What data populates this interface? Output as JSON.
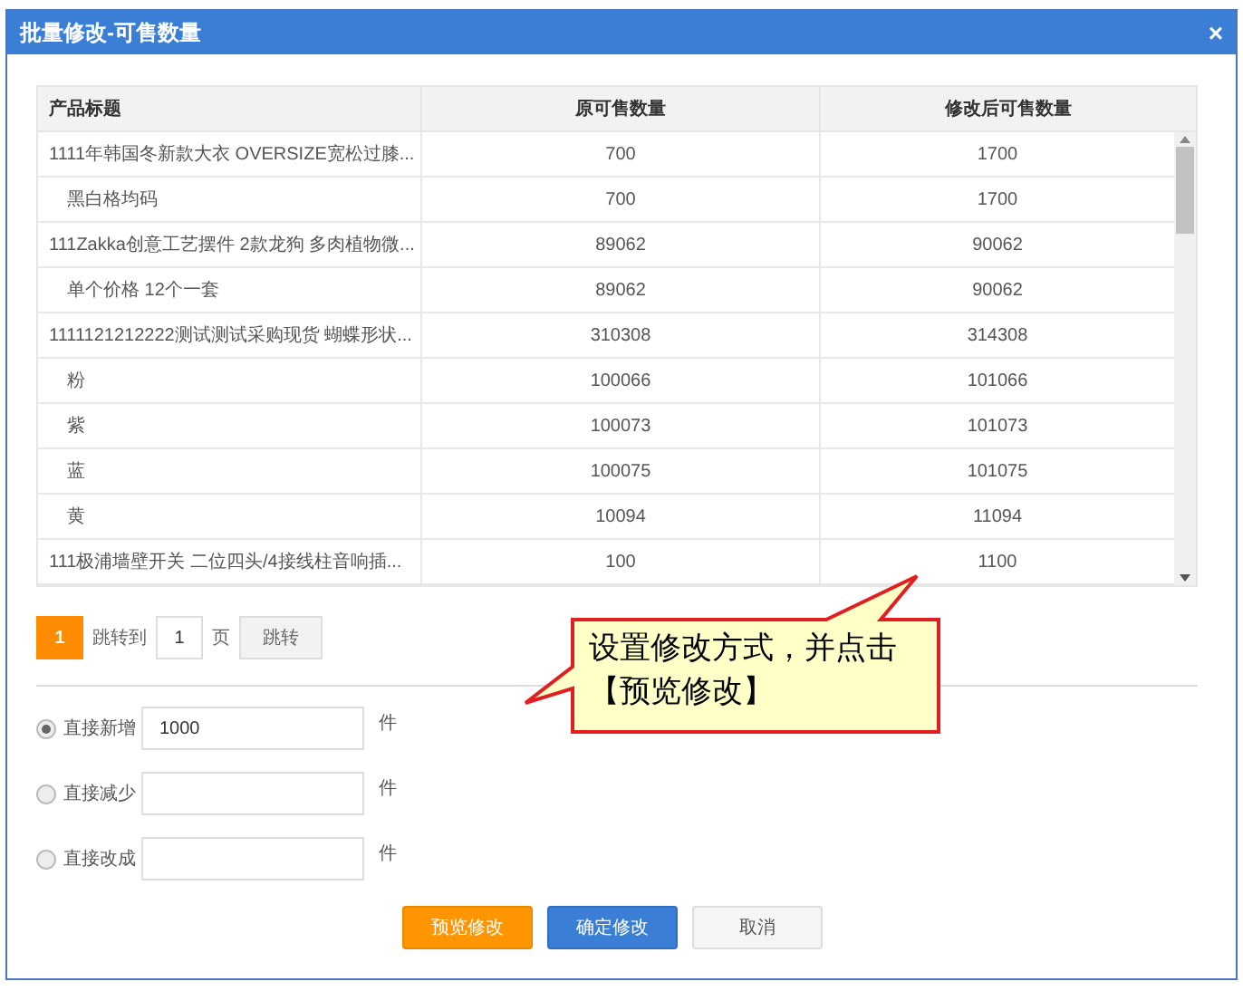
{
  "dialog": {
    "title": "批量修改-可售数量",
    "close": "×"
  },
  "table": {
    "columns": [
      "产品标题",
      "原可售数量",
      "修改后可售数量"
    ],
    "rows": [
      {
        "kind": "product",
        "title": "1111年韩国冬新款大衣 OVERSIZE宽松过膝...",
        "original": "700",
        "modified": "1700"
      },
      {
        "kind": "variant",
        "title": "黑白格均码",
        "original": "700",
        "modified": "1700"
      },
      {
        "kind": "product",
        "title": "111Zakka创意工艺摆件 2款龙狗 多肉植物微...",
        "original": "89062",
        "modified": "90062"
      },
      {
        "kind": "variant",
        "title": "单个价格 12个一套",
        "original": "89062",
        "modified": "90062"
      },
      {
        "kind": "product",
        "title": "1111121212222测试测试采购现货 蝴蝶形状...",
        "original": "310308",
        "modified": "314308"
      },
      {
        "kind": "variant",
        "title": "粉",
        "original": "100066",
        "modified": "101066"
      },
      {
        "kind": "variant",
        "title": "紫",
        "original": "100073",
        "modified": "101073"
      },
      {
        "kind": "variant",
        "title": "蓝",
        "original": "100075",
        "modified": "101075"
      },
      {
        "kind": "variant",
        "title": "黄",
        "original": "10094",
        "modified": "11094"
      },
      {
        "kind": "product",
        "title": "111极浦墙壁开关 二位四头/4接线柱音响插...",
        "original": "100",
        "modified": "1100"
      }
    ]
  },
  "pagination": {
    "current_page": "1",
    "jump_label": "跳转到",
    "page_value": "1",
    "page_unit": "页",
    "jump_button": "跳转"
  },
  "options": [
    {
      "label": "直接新增",
      "selected": true,
      "value": "1000",
      "unit": "件"
    },
    {
      "label": "直接减少",
      "selected": false,
      "unit": "件"
    },
    {
      "label": "直接改成",
      "selected": false,
      "unit": "件"
    }
  ],
  "buttons": [
    {
      "label": "预览修改",
      "kind": "warning"
    },
    {
      "label": "确定修改",
      "kind": "primary"
    },
    {
      "label": "取消",
      "kind": "default"
    }
  ],
  "callout": {
    "text": "设置修改方式，并点击【预览修改】"
  }
}
